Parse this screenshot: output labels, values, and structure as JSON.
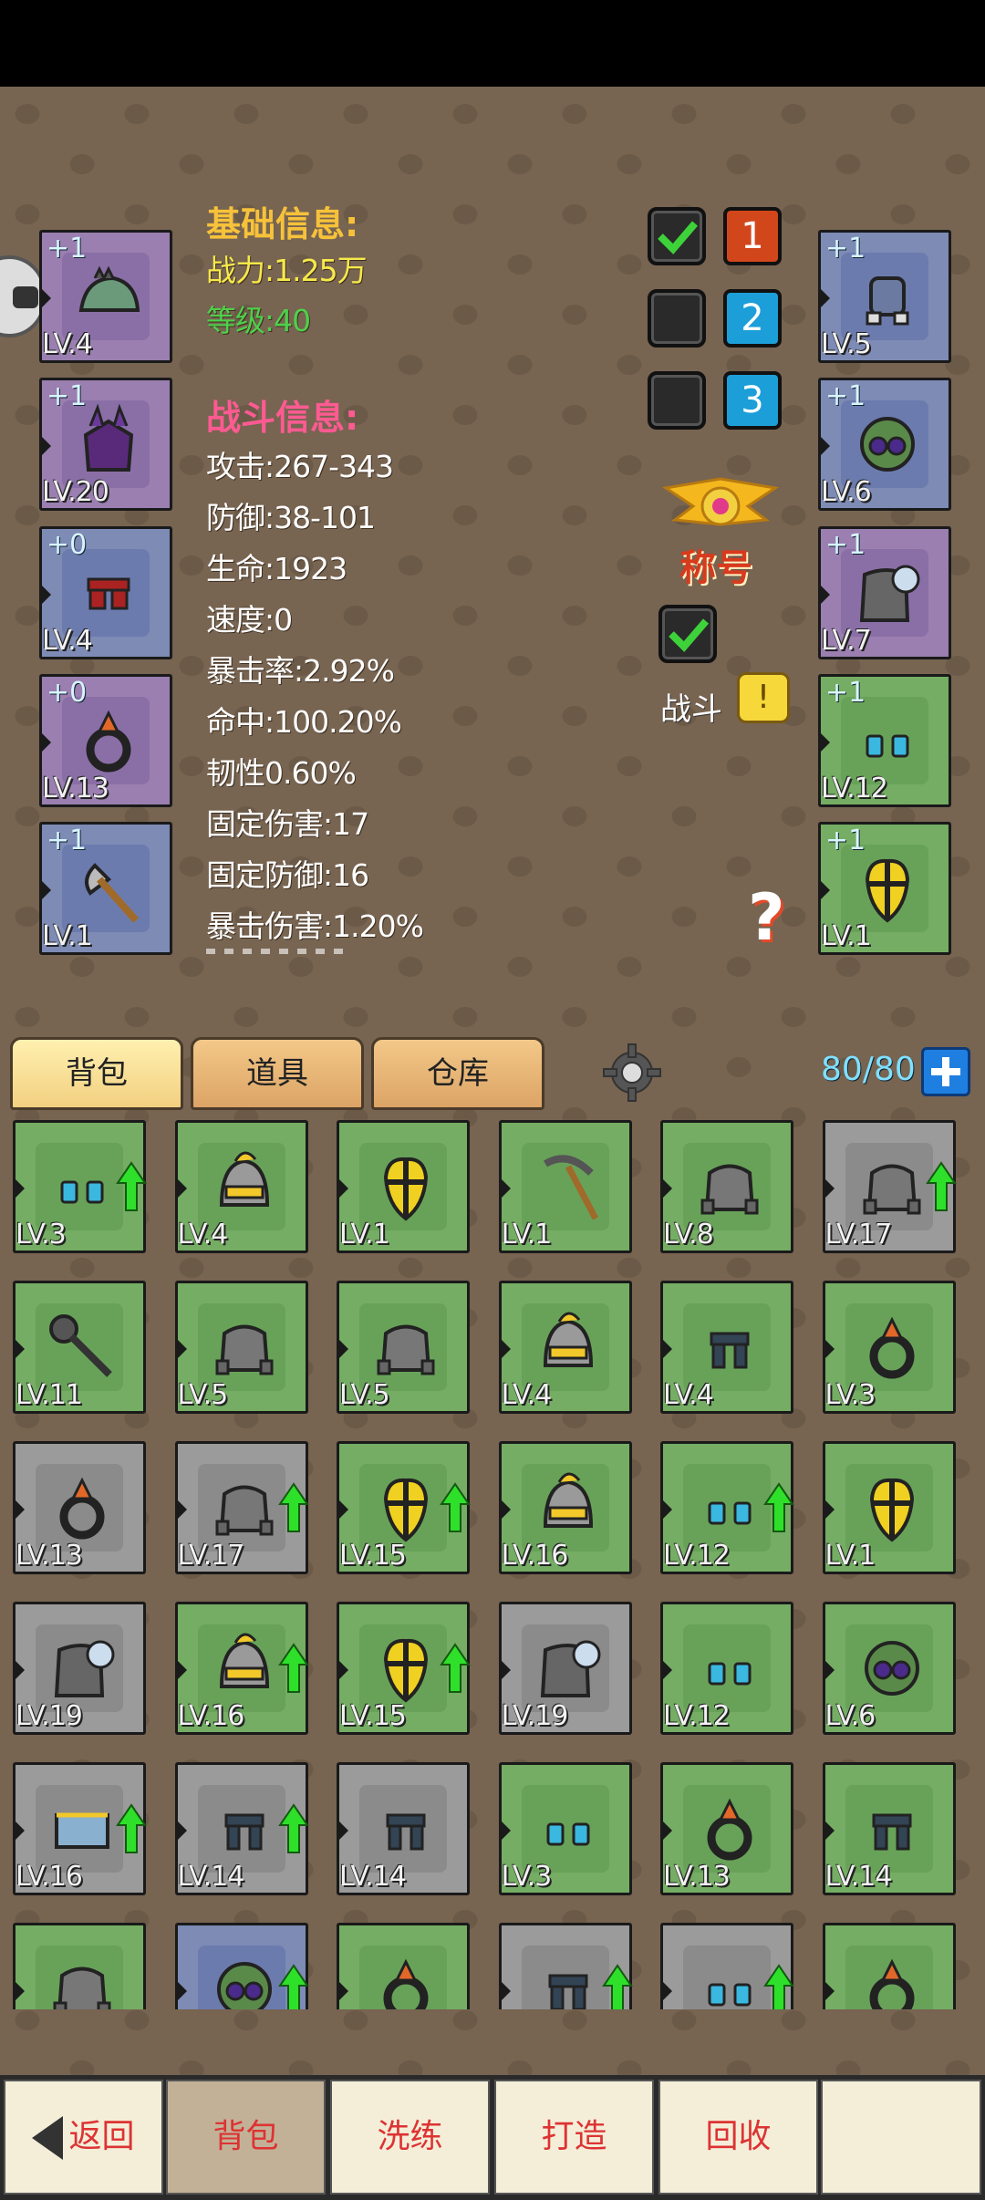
{
  "hero": {
    "basic_title": "基础信息:",
    "power": "战力:1.25万",
    "level": "等级:40",
    "combat_title": "战斗信息:",
    "stats": [
      "攻击:267-343",
      "防御:38-101",
      "生命:1923",
      "速度:0",
      "暴击率:2.92%",
      "命中:100.20%",
      "韧性0.60%",
      "固定伤害:17",
      "固定防御:16",
      "暴击伤害:1.20%"
    ]
  },
  "equipped_left": [
    {
      "plus": "+1",
      "lv": "LV.4",
      "rarity": "purple",
      "icon": "dino-helmet-icon"
    },
    {
      "plus": "+1",
      "lv": "LV.20",
      "rarity": "purple",
      "icon": "spiked-armor-icon"
    },
    {
      "plus": "+0",
      "lv": "LV.4",
      "rarity": "blue",
      "icon": "shorts-icon"
    },
    {
      "plus": "+0",
      "lv": "LV.13",
      "rarity": "purple",
      "icon": "ring-icon"
    },
    {
      "plus": "+1",
      "lv": "LV.1",
      "rarity": "blue",
      "icon": "axe-icon"
    }
  ],
  "equipped_right": [
    {
      "plus": "+1",
      "lv": "LV.5",
      "rarity": "blue",
      "icon": "gloves-icon"
    },
    {
      "plus": "+1",
      "lv": "LV.6",
      "rarity": "blue",
      "icon": "goggles-head-icon"
    },
    {
      "plus": "+1",
      "lv": "LV.7",
      "rarity": "purple",
      "icon": "cape-icon"
    },
    {
      "plus": "+1",
      "lv": "LV.12",
      "rarity": "green",
      "icon": "boots-icon"
    },
    {
      "plus": "+1",
      "lv": "LV.1",
      "rarity": "green",
      "icon": "shield-icon"
    }
  ],
  "presets": [
    {
      "num": "1",
      "checked": true,
      "color": "#d2461c"
    },
    {
      "num": "2",
      "checked": false,
      "color": "#1c9ed8"
    },
    {
      "num": "3",
      "checked": false,
      "color": "#1c9ed8"
    }
  ],
  "title_label": "称号",
  "battle_label": "战斗",
  "help_symbol": "?",
  "alert_symbol": "!",
  "tabs": [
    "背包",
    "道具",
    "仓库"
  ],
  "capacity": "80/80",
  "inventory": [
    {
      "lv": "LV.3",
      "rarity": "green",
      "up": true,
      "icon": "boots-icon"
    },
    {
      "lv": "LV.4",
      "rarity": "green",
      "up": false,
      "icon": "helmet-icon"
    },
    {
      "lv": "LV.1",
      "rarity": "green",
      "up": false,
      "icon": "shield-icon"
    },
    {
      "lv": "LV.1",
      "rarity": "green",
      "up": false,
      "icon": "pickaxe-icon"
    },
    {
      "lv": "LV.8",
      "rarity": "green",
      "up": false,
      "icon": "armor-icon"
    },
    {
      "lv": "LV.17",
      "rarity": "grey",
      "up": true,
      "icon": "armor-icon"
    },
    {
      "lv": "LV.11",
      "rarity": "green",
      "up": false,
      "icon": "mace-icon"
    },
    {
      "lv": "LV.5",
      "rarity": "green",
      "up": false,
      "icon": "armor-icon"
    },
    {
      "lv": "LV.5",
      "rarity": "green",
      "up": false,
      "icon": "armor-icon"
    },
    {
      "lv": "LV.4",
      "rarity": "green",
      "up": false,
      "icon": "helmet-icon"
    },
    {
      "lv": "LV.4",
      "rarity": "green",
      "up": false,
      "icon": "pants-icon"
    },
    {
      "lv": "LV.3",
      "rarity": "green",
      "up": false,
      "icon": "ring-icon"
    },
    {
      "lv": "LV.13",
      "rarity": "grey",
      "up": false,
      "icon": "ring-icon"
    },
    {
      "lv": "LV.17",
      "rarity": "grey",
      "up": true,
      "icon": "armor-icon"
    },
    {
      "lv": "LV.15",
      "rarity": "green",
      "up": true,
      "icon": "shield-icon"
    },
    {
      "lv": "LV.16",
      "rarity": "green",
      "up": false,
      "icon": "helmet-icon"
    },
    {
      "lv": "LV.12",
      "rarity": "green",
      "up": true,
      "icon": "boots-icon"
    },
    {
      "lv": "LV.1",
      "rarity": "green",
      "up": false,
      "icon": "shield-icon"
    },
    {
      "lv": "LV.19",
      "rarity": "grey",
      "up": false,
      "icon": "cape-icon"
    },
    {
      "lv": "LV.16",
      "rarity": "green",
      "up": true,
      "icon": "helmet-icon"
    },
    {
      "lv": "LV.15",
      "rarity": "green",
      "up": true,
      "icon": "shield-icon"
    },
    {
      "lv": "LV.19",
      "rarity": "grey",
      "up": false,
      "icon": "cape-icon"
    },
    {
      "lv": "LV.12",
      "rarity": "green",
      "up": false,
      "icon": "boots-icon"
    },
    {
      "lv": "LV.6",
      "rarity": "green",
      "up": false,
      "icon": "goggles-head-icon"
    },
    {
      "lv": "LV.16",
      "rarity": "grey",
      "up": true,
      "icon": "crown-icon"
    },
    {
      "lv": "LV.14",
      "rarity": "grey",
      "up": true,
      "icon": "pants-icon"
    },
    {
      "lv": "LV.14",
      "rarity": "grey",
      "up": false,
      "icon": "pants-icon"
    },
    {
      "lv": "LV.3",
      "rarity": "green",
      "up": false,
      "icon": "boots-icon"
    },
    {
      "lv": "LV.13",
      "rarity": "green",
      "up": false,
      "icon": "ring-icon"
    },
    {
      "lv": "LV.14",
      "rarity": "green",
      "up": false,
      "icon": "pants-icon"
    },
    {
      "lv": "",
      "rarity": "green",
      "up": false,
      "icon": "armor-icon"
    },
    {
      "lv": "",
      "rarity": "blue",
      "up": true,
      "icon": "goggles-head-icon"
    },
    {
      "lv": "",
      "rarity": "green",
      "up": false,
      "icon": "ring-icon"
    },
    {
      "lv": "",
      "rarity": "grey",
      "up": true,
      "icon": "pants-icon"
    },
    {
      "lv": "",
      "rarity": "grey",
      "up": true,
      "icon": "boots-icon"
    },
    {
      "lv": "",
      "rarity": "green",
      "up": false,
      "icon": "ring-icon"
    }
  ],
  "nav": {
    "back": "返回",
    "items": [
      "背包",
      "洗练",
      "打造",
      "回收"
    ]
  }
}
